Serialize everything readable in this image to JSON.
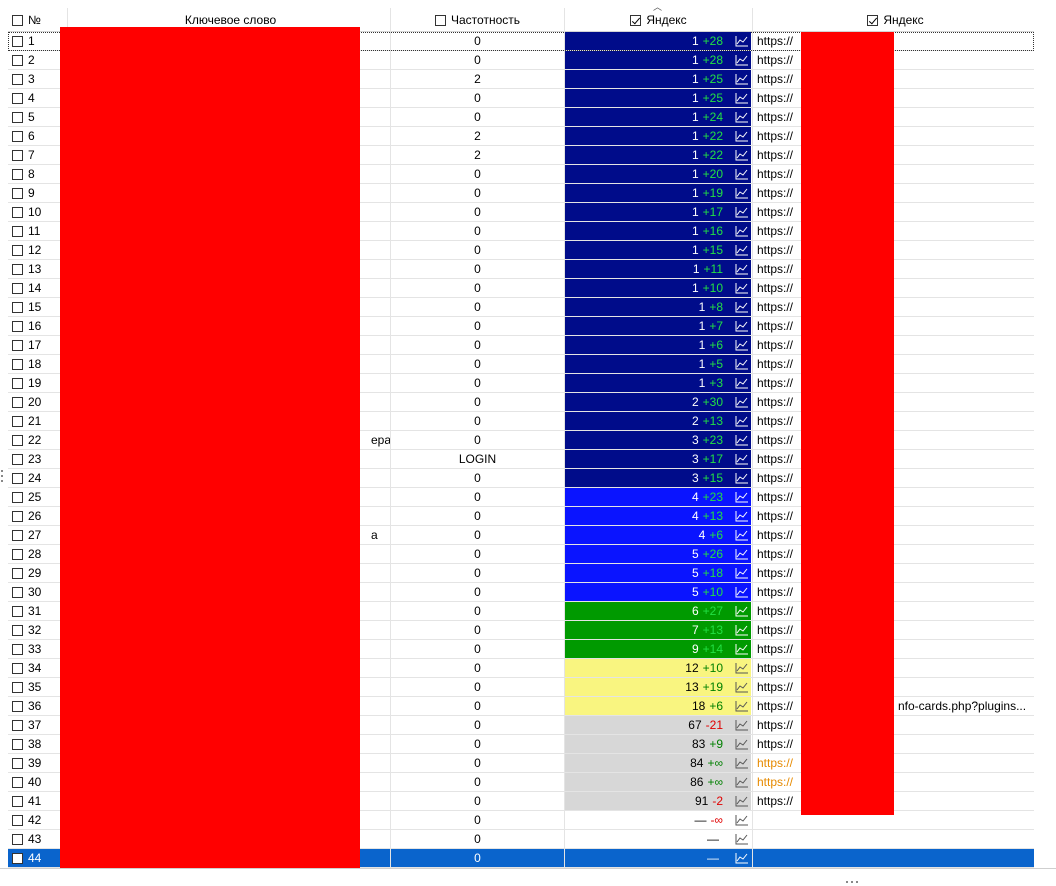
{
  "header": {
    "num": "№",
    "keyword": "Ключевое слово",
    "frequency": "Частотность",
    "yandex_rank": "Яндекс",
    "yandex_url": "Яндекс"
  },
  "colors": {
    "dark_navy": "#000c8a",
    "blue": "#0a14ff",
    "green": "#009a00",
    "yellow": "#f9f580",
    "gray": "#d7d7d7",
    "white": "#ffffff",
    "delta_pos_on_dark": "#22e044",
    "delta_pos_on_light": "#008000",
    "delta_neg": "#e00000",
    "selected_row": "#0a64cc",
    "redaction": "#ff0000"
  },
  "rows": [
    {
      "n": "1",
      "kw": "",
      "freq": "0",
      "rank": "1",
      "delta": "+28",
      "color": "dark_navy",
      "url": "https://",
      "url_color": "normal",
      "focus": true
    },
    {
      "n": "2",
      "kw": "",
      "freq": "0",
      "rank": "1",
      "delta": "+28",
      "color": "dark_navy",
      "url": "https://"
    },
    {
      "n": "3",
      "kw": "",
      "freq": "2",
      "rank": "1",
      "delta": "+25",
      "color": "dark_navy",
      "url": "https://"
    },
    {
      "n": "4",
      "kw": "",
      "freq": "0",
      "rank": "1",
      "delta": "+25",
      "color": "dark_navy",
      "url": "https://"
    },
    {
      "n": "5",
      "kw": "",
      "freq": "0",
      "rank": "1",
      "delta": "+24",
      "color": "dark_navy",
      "url": "https://"
    },
    {
      "n": "6",
      "kw": "",
      "freq": "2",
      "rank": "1",
      "delta": "+22",
      "color": "dark_navy",
      "url": "https://"
    },
    {
      "n": "7",
      "kw": "",
      "freq": "2",
      "rank": "1",
      "delta": "+22",
      "color": "dark_navy",
      "url": "https://"
    },
    {
      "n": "8",
      "kw": "",
      "freq": "0",
      "rank": "1",
      "delta": "+20",
      "color": "dark_navy",
      "url": "https://"
    },
    {
      "n": "9",
      "kw": "",
      "freq": "0",
      "rank": "1",
      "delta": "+19",
      "color": "dark_navy",
      "url": "https://"
    },
    {
      "n": "10",
      "kw": "",
      "freq": "0",
      "rank": "1",
      "delta": "+17",
      "color": "dark_navy",
      "url": "https://"
    },
    {
      "n": "11",
      "kw": "",
      "freq": "0",
      "rank": "1",
      "delta": "+16",
      "color": "dark_navy",
      "url": "https://"
    },
    {
      "n": "12",
      "kw": "",
      "freq": "0",
      "rank": "1",
      "delta": "+15",
      "color": "dark_navy",
      "url": "https://"
    },
    {
      "n": "13",
      "kw": "",
      "freq": "0",
      "rank": "1",
      "delta": "+11",
      "color": "dark_navy",
      "url": "https://"
    },
    {
      "n": "14",
      "kw": "",
      "freq": "0",
      "rank": "1",
      "delta": "+10",
      "color": "dark_navy",
      "url": "https://"
    },
    {
      "n": "15",
      "kw": "",
      "freq": "0",
      "rank": "1",
      "delta": "+8",
      "color": "dark_navy",
      "url": "https://"
    },
    {
      "n": "16",
      "kw": "",
      "freq": "0",
      "rank": "1",
      "delta": "+7",
      "color": "dark_navy",
      "url": "https://"
    },
    {
      "n": "17",
      "kw": "",
      "freq": "0",
      "rank": "1",
      "delta": "+6",
      "color": "dark_navy",
      "url": "https://"
    },
    {
      "n": "18",
      "kw": "",
      "freq": "0",
      "rank": "1",
      "delta": "+5",
      "color": "dark_navy",
      "url": "https://"
    },
    {
      "n": "19",
      "kw": "",
      "freq": "0",
      "rank": "1",
      "delta": "+3",
      "color": "dark_navy",
      "url": "https://"
    },
    {
      "n": "20",
      "kw": "",
      "freq": "0",
      "rank": "2",
      "delta": "+30",
      "color": "dark_navy",
      "url": "https://"
    },
    {
      "n": "21",
      "kw": "",
      "freq": "0",
      "rank": "2",
      "delta": "+13",
      "color": "dark_navy",
      "url": "https://"
    },
    {
      "n": "22",
      "kw": "ера",
      "freq": "0",
      "rank": "3",
      "delta": "+23",
      "color": "dark_navy",
      "url": "https://"
    },
    {
      "n": "23",
      "kw": "",
      "freq": "LOGIN",
      "rank": "3",
      "delta": "+17",
      "color": "dark_navy",
      "url": "https://"
    },
    {
      "n": "24",
      "kw": "",
      "freq": "0",
      "rank": "3",
      "delta": "+15",
      "color": "dark_navy",
      "url": "https://"
    },
    {
      "n": "25",
      "kw": "",
      "freq": "0",
      "rank": "4",
      "delta": "+23",
      "color": "blue",
      "url": "https://"
    },
    {
      "n": "26",
      "kw": "",
      "freq": "0",
      "rank": "4",
      "delta": "+13",
      "color": "blue",
      "url": "https://"
    },
    {
      "n": "27",
      "kw": "а",
      "freq": "0",
      "rank": "4",
      "delta": "+6",
      "color": "blue",
      "url": "https://"
    },
    {
      "n": "28",
      "kw": "",
      "freq": "0",
      "rank": "5",
      "delta": "+26",
      "color": "blue",
      "url": "https://"
    },
    {
      "n": "29",
      "kw": "",
      "freq": "0",
      "rank": "5",
      "delta": "+18",
      "color": "blue",
      "url": "https://"
    },
    {
      "n": "30",
      "kw": "",
      "freq": "0",
      "rank": "5",
      "delta": "+10",
      "color": "blue",
      "url": "https://"
    },
    {
      "n": "31",
      "kw": "",
      "freq": "0",
      "rank": "6",
      "delta": "+27",
      "color": "green",
      "url": "https://"
    },
    {
      "n": "32",
      "kw": "",
      "freq": "0",
      "rank": "7",
      "delta": "+13",
      "color": "green",
      "url": "https://"
    },
    {
      "n": "33",
      "kw": "",
      "freq": "0",
      "rank": "9",
      "delta": "+14",
      "color": "green",
      "url": "https://"
    },
    {
      "n": "34",
      "kw": "",
      "freq": "0",
      "rank": "12",
      "delta": "+10",
      "color": "yellow",
      "url": "https://"
    },
    {
      "n": "35",
      "kw": "",
      "freq": "0",
      "rank": "13",
      "delta": "+19",
      "color": "yellow",
      "url": "https://"
    },
    {
      "n": "36",
      "kw": "",
      "freq": "0",
      "rank": "18",
      "delta": "+6",
      "color": "yellow",
      "url": "https://",
      "url_tail": "nfo-cards.php?plugins..."
    },
    {
      "n": "37",
      "kw": "",
      "freq": "0",
      "rank": "67",
      "delta": "-21",
      "color": "gray",
      "url": "https://"
    },
    {
      "n": "38",
      "kw": "",
      "freq": "0",
      "rank": "83",
      "delta": "+9",
      "color": "gray",
      "url": "https://"
    },
    {
      "n": "39",
      "kw": "",
      "freq": "0",
      "rank": "84",
      "delta": "+∞",
      "color": "gray",
      "url": "https://",
      "url_color": "orange"
    },
    {
      "n": "40",
      "kw": "",
      "freq": "0",
      "rank": "86",
      "delta": "+∞",
      "color": "gray",
      "url": "https://",
      "url_color": "orange"
    },
    {
      "n": "41",
      "kw": "",
      "freq": "0",
      "rank": "91",
      "delta": "-2",
      "color": "gray",
      "url": "https://"
    },
    {
      "n": "42",
      "kw": "",
      "freq": "0",
      "rank": "—",
      "delta": "-∞",
      "color": "white",
      "url": ""
    },
    {
      "n": "43",
      "kw": "",
      "freq": "0",
      "rank": "—",
      "delta": "",
      "color": "white",
      "url": ""
    },
    {
      "n": "44",
      "kw": "",
      "freq": "0",
      "rank": "—",
      "delta": "",
      "color": "white",
      "url": "",
      "selected": true
    }
  ]
}
